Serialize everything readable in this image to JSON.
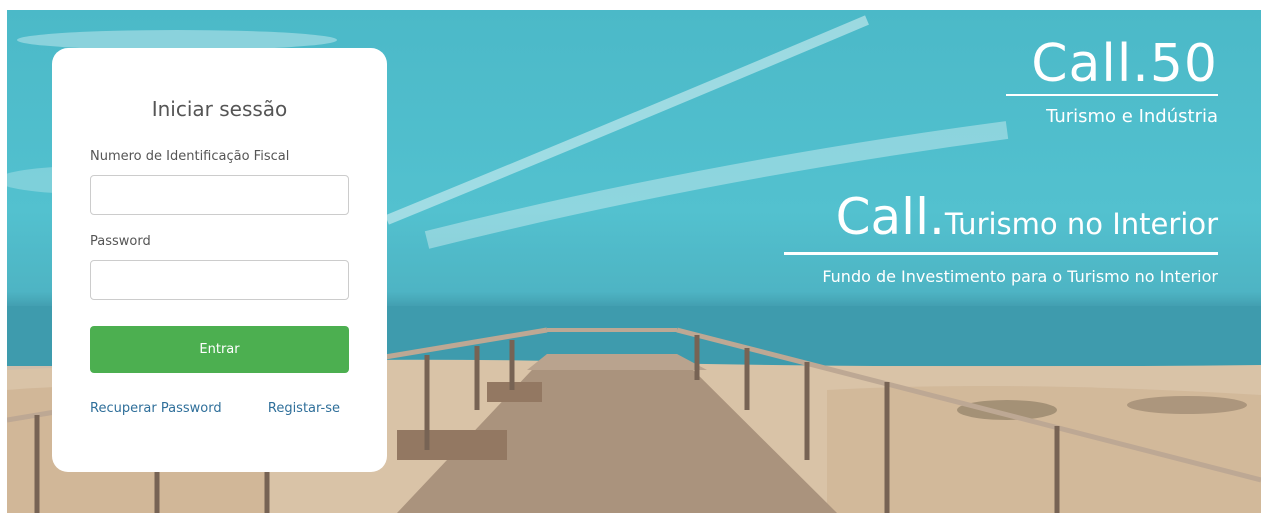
{
  "login": {
    "title": "Iniciar sessão",
    "nif_label": "Numero de Identificação Fiscal",
    "nif_value": "",
    "password_label": "Password",
    "password_value": "",
    "submit_label": "Entrar",
    "recover_link": "Recuperar Password",
    "register_link": "Registar-se"
  },
  "brand_primary": {
    "logo_text": "Call.50",
    "subtitle": "Turismo e Indústria"
  },
  "brand_secondary": {
    "logo_call": "Call",
    "logo_dot": ".",
    "logo_title": "Turismo no Interior",
    "subtitle": "Fundo de Investimento para o Turismo no Interior"
  },
  "colors": {
    "accent_green": "#4caf50",
    "link_blue": "#2f6f9a",
    "sky": "#3cb4c4",
    "sand": "#d8c0a2"
  }
}
